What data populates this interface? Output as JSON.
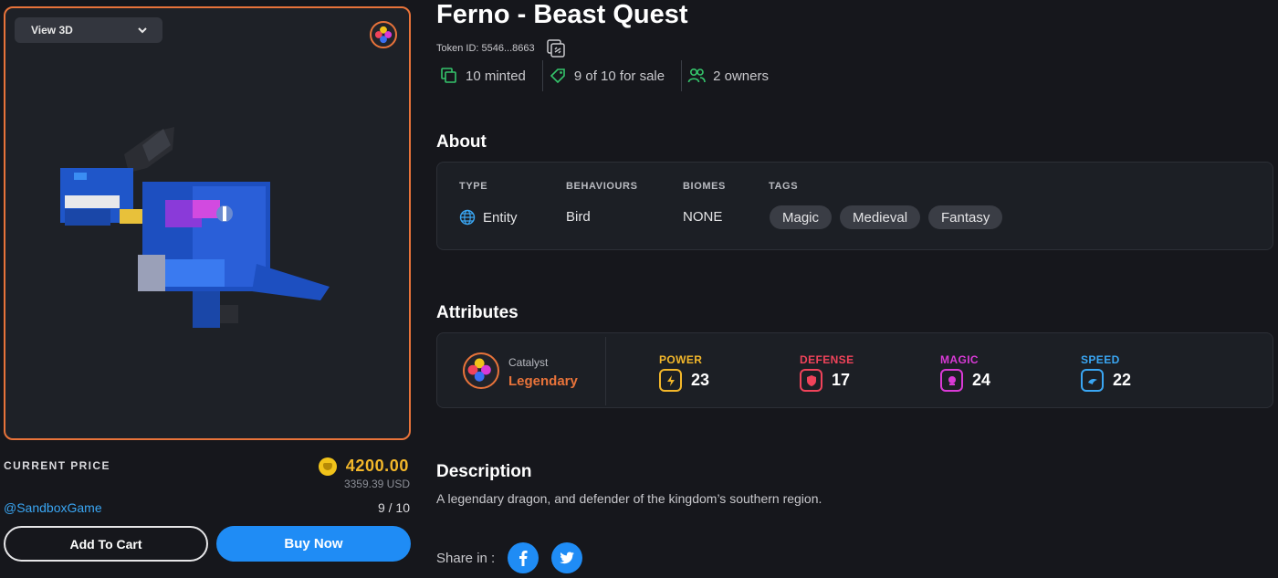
{
  "viewer": {
    "view_label": "View 3D"
  },
  "price": {
    "label": "CURRENT PRICE",
    "amount": "4200.00",
    "usd": "3359.39 USD",
    "creator": "@SandboxGame",
    "edition": "9 / 10",
    "add_to_cart": "Add To Cart",
    "buy_now": "Buy Now"
  },
  "asset": {
    "title": "Ferno - Beast Quest",
    "token_id": "Token ID: 5546...8663",
    "stats": {
      "minted": "10 minted",
      "for_sale": "9 of 10 for sale",
      "owners": "2 owners"
    }
  },
  "about": {
    "heading": "About",
    "type_head": "TYPE",
    "type_val": "Entity",
    "behaviours_head": "BEHAVIOURS",
    "behaviours_val": "Bird",
    "biomes_head": "BIOMES",
    "biomes_val": "NONE",
    "tags_head": "TAGS",
    "tags": [
      "Magic",
      "Medieval",
      "Fantasy"
    ]
  },
  "attributes": {
    "heading": "Attributes",
    "catalyst_label": "Catalyst",
    "catalyst_value": "Legendary",
    "items": [
      {
        "name": "POWER",
        "value": "23",
        "color": "#f3b72a",
        "icon": "lightning-icon"
      },
      {
        "name": "DEFENSE",
        "value": "17",
        "color": "#f0435a",
        "icon": "shield-icon"
      },
      {
        "name": "MAGIC",
        "value": "24",
        "color": "#d93ad6",
        "icon": "magic-icon"
      },
      {
        "name": "SPEED",
        "value": "22",
        "color": "#3aa6f3",
        "icon": "wind-icon"
      }
    ]
  },
  "description": {
    "heading": "Description",
    "text": "A legendary dragon, and defender of the kingdom’s southern region."
  },
  "share": {
    "label": "Share in :"
  },
  "colors": {
    "accent_orange": "#e8733a",
    "buy_blue": "#1f8cf5",
    "stat_green": "#35c46b",
    "link_blue": "#3aa6f3"
  }
}
